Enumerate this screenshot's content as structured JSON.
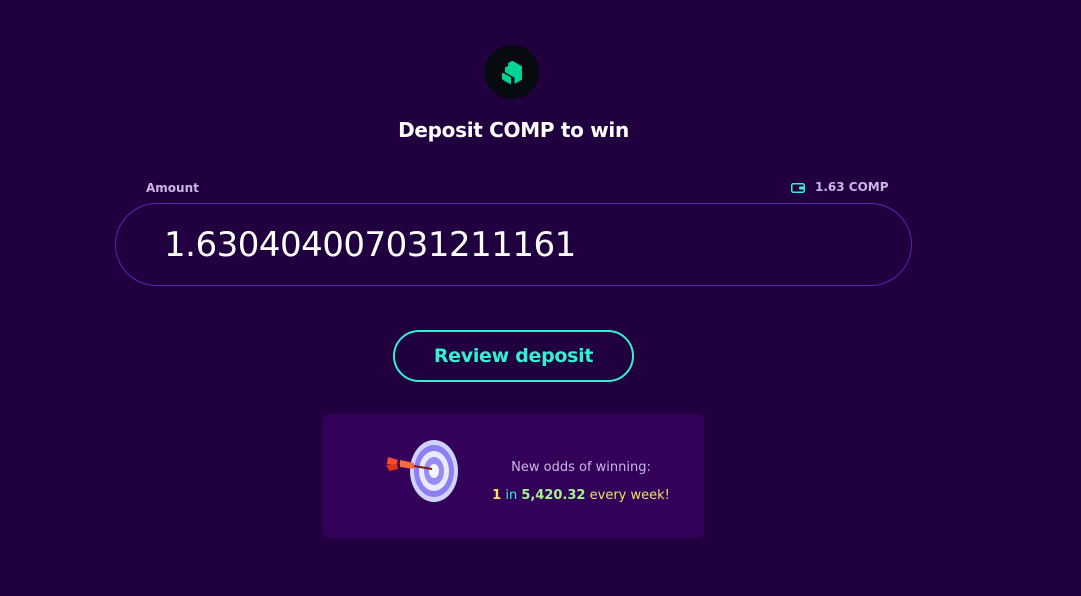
{
  "token_logo": {
    "icon": "compound-logo-icon",
    "accent": "#00d395"
  },
  "header": {
    "title": "Deposit COMP to win"
  },
  "amount": {
    "label": "Amount",
    "value": "1.630404007031211161",
    "balance_icon": "wallet-icon",
    "balance_text": "1.63 COMP"
  },
  "actions": {
    "review_label": "Review deposit"
  },
  "odds": {
    "icon": "dartboard-icon",
    "heading": "New odds of winning:",
    "one": "1",
    "in": "in",
    "number": "5,420.32",
    "tail": "every week!"
  },
  "colors": {
    "background": "#21003f",
    "accent": "#35f0d0",
    "card": "#34015a"
  }
}
